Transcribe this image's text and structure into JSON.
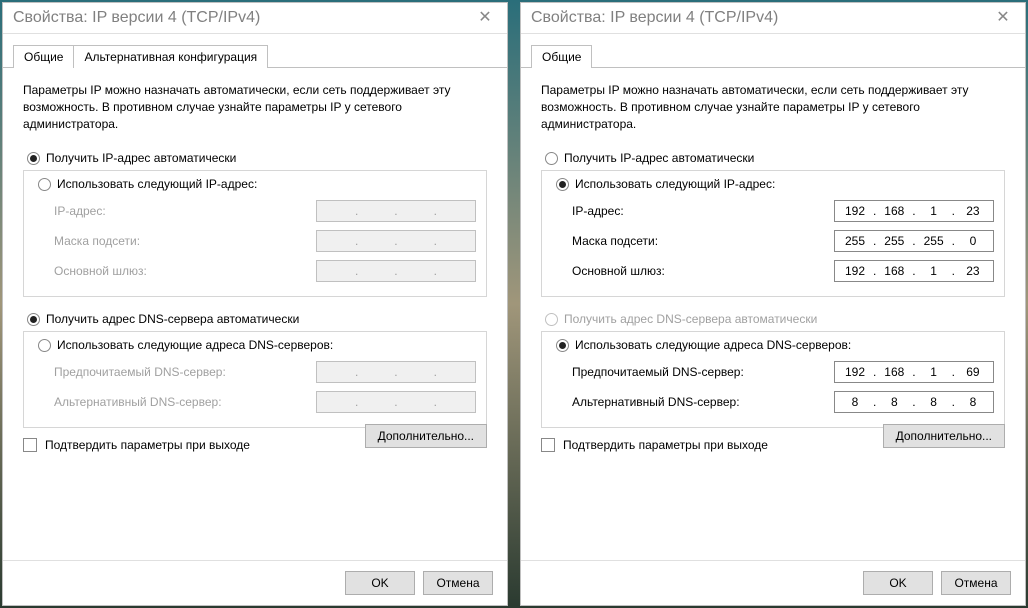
{
  "left": {
    "title": "Свойства: IP версии 4 (TCP/IPv4)",
    "tabs": [
      "Общие",
      "Альтернативная конфигурация"
    ],
    "intro": "Параметры IP можно назначать автоматически, если сеть поддерживает эту возможность. В противном случае узнайте параметры IP у сетевого администратора.",
    "radio_auto_ip": "Получить IP-адрес автоматически",
    "radio_manual_ip": "Использовать следующий IP-адрес:",
    "lbl_ip": "IP-адрес:",
    "lbl_mask": "Маска подсети:",
    "lbl_gw": "Основной шлюз:",
    "radio_auto_dns": "Получить адрес DNS-сервера автоматически",
    "radio_manual_dns": "Использовать следующие адреса DNS-серверов:",
    "lbl_dns1": "Предпочитаемый DNS-сервер:",
    "lbl_dns2": "Альтернативный DNS-сервер:",
    "confirm": "Подтвердить параметры при выходе",
    "advanced": "Дополнительно...",
    "ok": "OK",
    "cancel": "Отмена",
    "ip_selected": "auto",
    "dns_selected": "auto",
    "ip": [
      "",
      "",
      "",
      ""
    ],
    "mask": [
      "",
      "",
      "",
      ""
    ],
    "gw": [
      "",
      "",
      "",
      ""
    ],
    "dns1": [
      "",
      "",
      "",
      ""
    ],
    "dns2": [
      "",
      "",
      "",
      ""
    ]
  },
  "right": {
    "title": "Свойства: IP версии 4 (TCP/IPv4)",
    "tabs": [
      "Общие"
    ],
    "intro": "Параметры IP можно назначать автоматически, если сеть поддерживает эту возможность. В противном случае узнайте параметры IP у сетевого администратора.",
    "radio_auto_ip": "Получить IP-адрес автоматически",
    "radio_manual_ip": "Использовать следующий IP-адрес:",
    "lbl_ip": "IP-адрес:",
    "lbl_mask": "Маска подсети:",
    "lbl_gw": "Основной шлюз:",
    "radio_auto_dns": "Получить адрес DNS-сервера автоматически",
    "radio_manual_dns": "Использовать следующие адреса DNS-серверов:",
    "lbl_dns1": "Предпочитаемый DNS-сервер:",
    "lbl_dns2": "Альтернативный DNS-сервер:",
    "confirm": "Подтвердить параметры при выходе",
    "advanced": "Дополнительно...",
    "ok": "OK",
    "cancel": "Отмена",
    "ip_selected": "manual",
    "dns_selected": "manual",
    "ip": [
      "192",
      "168",
      "1",
      "23"
    ],
    "mask": [
      "255",
      "255",
      "255",
      "0"
    ],
    "gw": [
      "192",
      "168",
      "1",
      "23"
    ],
    "dns1": [
      "192",
      "168",
      "1",
      "69"
    ],
    "dns2": [
      "8",
      "8",
      "8",
      "8"
    ]
  }
}
